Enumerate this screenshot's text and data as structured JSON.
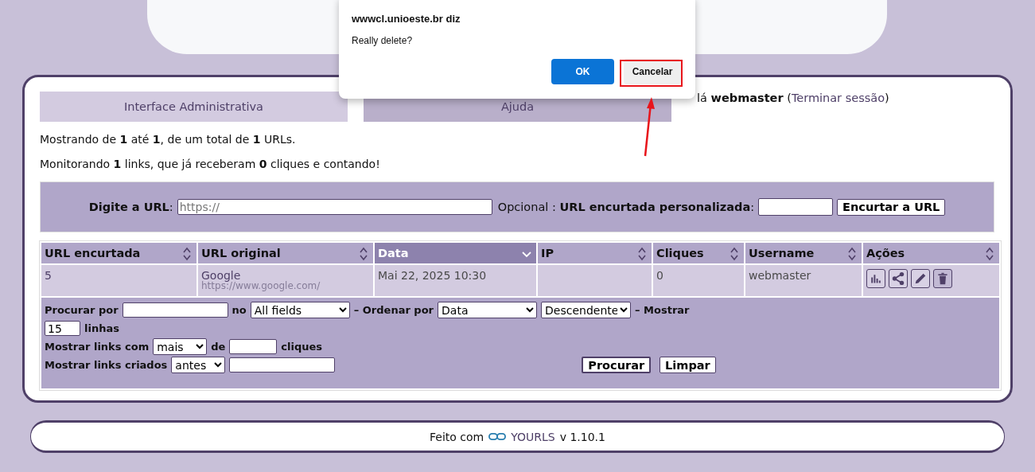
{
  "tabs": [
    {
      "label": "Interface Administrativa",
      "selected": true
    },
    {
      "label": "Ajuda",
      "selected": false
    }
  ],
  "greeting": {
    "text": "lá **webmaster** (",
    "link": "Terminar sessão",
    "after": ")"
  },
  "summary": [
    "Mostrando de **1** até **1**, de um total de **1** URLs.",
    "Monitorando **1** links, que já receberam **0** cliques e contando!"
  ],
  "new_url": {
    "label": "**Digite a URL**:",
    "placeholder": "https://",
    "optional_label": "Opcional : **URL encurtada personalizada**:",
    "button": "Encurtar a URL"
  },
  "table": {
    "columns": [
      {
        "label": "URL encurtada",
        "sorted": false
      },
      {
        "label": "URL original",
        "sorted": false
      },
      {
        "label": "Data",
        "sorted": true
      },
      {
        "label": "IP",
        "sorted": false
      },
      {
        "label": "Cliques",
        "sorted": false
      },
      {
        "label": "Username",
        "sorted": false
      },
      {
        "label": "Ações",
        "sorted": false
      }
    ],
    "rows": [
      {
        "short": "5",
        "title": "Google",
        "url": "https://www.google.com/",
        "date": "Mai 22, 2025 10:30",
        "ip": "",
        "clicks": "0",
        "user": "webmaster",
        "actions": [
          {
            "kind": "stats"
          },
          {
            "kind": "share"
          },
          {
            "kind": "edit"
          },
          {
            "kind": "delete"
          }
        ]
      }
    ]
  },
  "filter": {
    "search_label": "Procurar por",
    "in_label": "no",
    "in_value": "All fields",
    "order_label": "– Ordenar por",
    "order_value": "Data",
    "direction_value": "Descendente",
    "show_label": "– Mostrar",
    "rows_value": "15",
    "rows_label": "linhas",
    "clicks_label": "Mostrar links com",
    "clicks_op": "mais",
    "clicks_of": "de",
    "clicks_unit": "cliques",
    "created_label": "Mostrar links criados",
    "created_op": "antes",
    "search_button": "Procurar",
    "clear_button": "Limpar"
  },
  "footer": {
    "prefix": "Feito com",
    "link": "YOURLS",
    "version": "v 1.10.1"
  },
  "dialog": {
    "title": "wwwcl.unioeste.br diz",
    "message": "Really delete?",
    "buttons": [
      {
        "label": "OK",
        "kind": "primary"
      },
      {
        "label": "Cancelar",
        "kind": "secondary"
      }
    ]
  }
}
